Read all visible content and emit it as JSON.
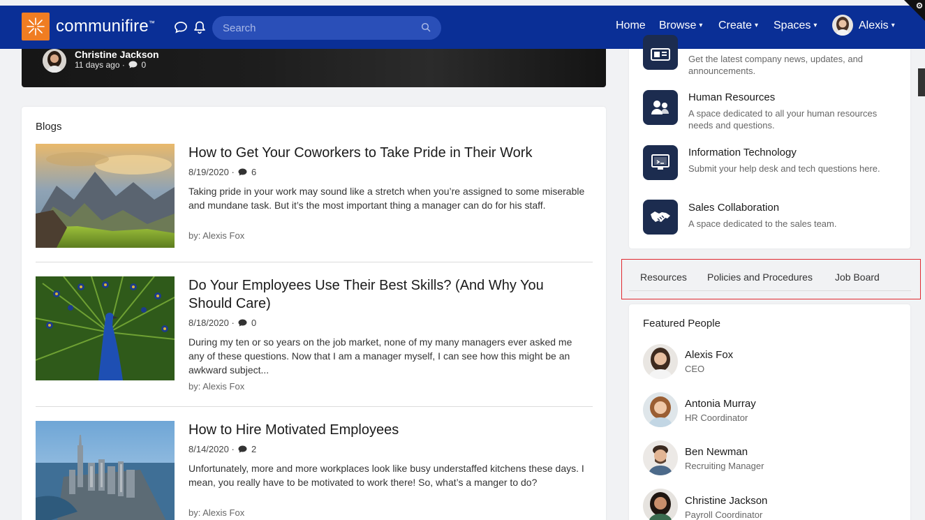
{
  "nav": {
    "brand": "communifire",
    "brand_mark": "™",
    "search_placeholder": "Search",
    "home": "Home",
    "browse": "Browse",
    "create": "Create",
    "spaces": "Spaces",
    "user": "Alexis",
    "caret": "▾"
  },
  "hero": {
    "author": "Christine Jackson",
    "age": "11 days ago ·",
    "comments": "0"
  },
  "blogs": {
    "title": "Blogs",
    "posts": [
      {
        "title": "How to Get Your Coworkers to Take Pride in Their Work",
        "date": "8/19/2020 ·",
        "comments": "6",
        "excerpt": "Taking pride in your work may sound like a stretch when you’re assigned to some miserable and mundane task. But it’s the most important thing a manager can do for his staff.",
        "author": "by: Alexis Fox"
      },
      {
        "title": "Do Your Employees Use Their Best Skills? (And Why You Should Care)",
        "date": "8/18/2020 ·",
        "comments": "0",
        "excerpt": "During my ten or so years on the job market, none of my many managers ever asked me any of these questions. Now that I am a manager myself, I can see how this might be an awkward subject...",
        "author": "by: Alexis Fox"
      },
      {
        "title": "How to Hire Motivated Employees",
        "date": "8/14/2020 ·",
        "comments": "2",
        "excerpt": "Unfortunately, more and more workplaces look like busy understaffed kitchens these days. I mean, you really have to be motivated to work there! So, what’s a manger to do?",
        "author": "by: Alexis Fox"
      }
    ]
  },
  "spaces": [
    {
      "name": "",
      "desc": "Get the latest company news, updates, and announcements."
    },
    {
      "name": "Human Resources",
      "desc": "A space dedicated to all your human resources needs and questions."
    },
    {
      "name": "Information Technology",
      "desc": "Submit your help desk and tech questions here."
    },
    {
      "name": "Sales Collaboration",
      "desc": "A space dedicated to the sales team."
    }
  ],
  "tabs": [
    "Resources",
    "Policies and Procedures",
    "Job Board"
  ],
  "people": {
    "title": "Featured People",
    "list": [
      {
        "name": "Alexis Fox",
        "role": "CEO"
      },
      {
        "name": "Antonia Murray",
        "role": "HR Coordinator"
      },
      {
        "name": "Ben Newman",
        "role": "Recruiting Manager"
      },
      {
        "name": "Christine Jackson",
        "role": "Payroll Coordinator"
      }
    ]
  },
  "colors": {
    "nav_bg": "#0a2f96",
    "logo_orange": "#f07d22",
    "space_icon_bg": "#1c2c4f",
    "highlight_border": "#e0282f"
  }
}
